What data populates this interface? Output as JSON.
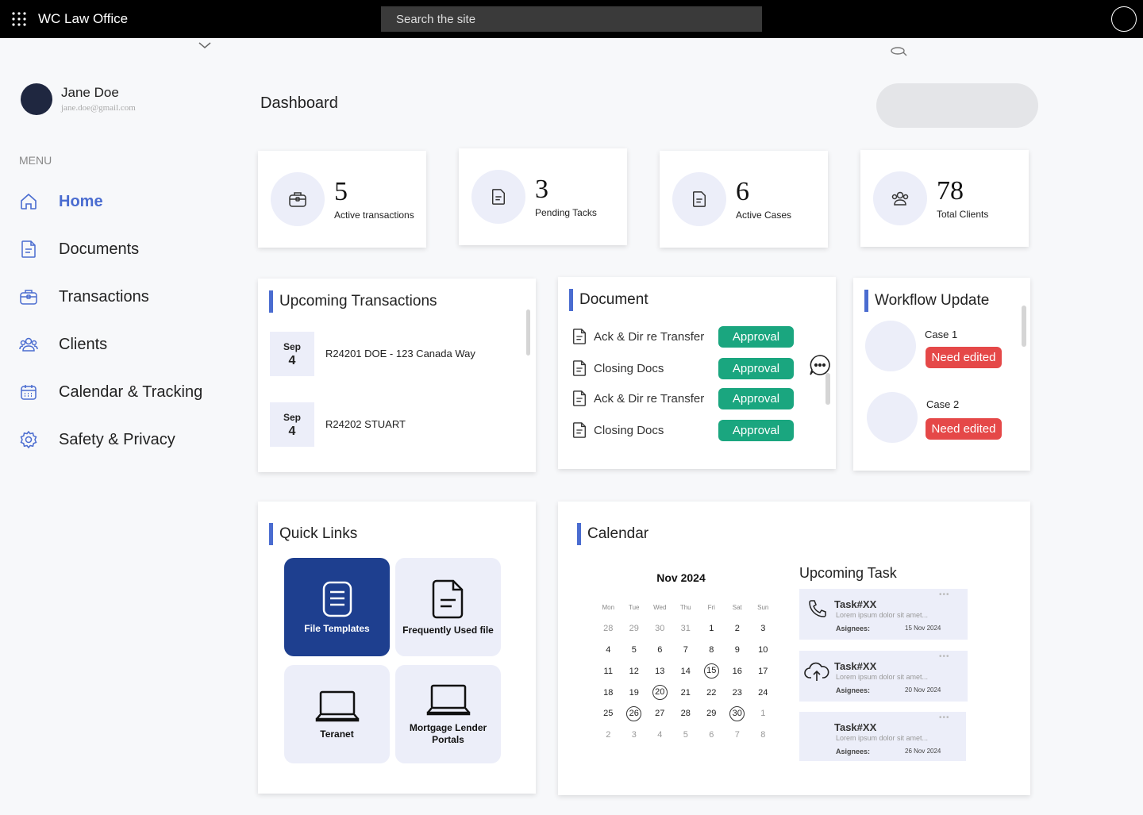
{
  "app": {
    "title": "WC Law Office",
    "search_placeholder": "Search the site"
  },
  "user": {
    "name": "Jane Doe",
    "email": "jane.doe@gmail.com"
  },
  "sidebar": {
    "menu_label": "MENU",
    "items": [
      {
        "label": "Home",
        "icon": "home-icon",
        "active": true
      },
      {
        "label": "Documents",
        "icon": "document-icon"
      },
      {
        "label": "Transactions",
        "icon": "briefcase-icon"
      },
      {
        "label": "Clients",
        "icon": "users-icon"
      },
      {
        "label": "Calendar & Tracking",
        "icon": "calendar-icon"
      },
      {
        "label": "Safety & Privacy",
        "icon": "gear-icon"
      }
    ]
  },
  "page": {
    "title": "Dashboard"
  },
  "stats": [
    {
      "value": "5",
      "label": "Active transactions",
      "icon": "briefcase-icon"
    },
    {
      "value": "3",
      "label": "Pending Tacks",
      "icon": "document-icon"
    },
    {
      "value": "6",
      "label": "Active Cases",
      "icon": "document-icon"
    },
    {
      "value": "78",
      "label": "Total Clients",
      "icon": "users-icon"
    }
  ],
  "upcoming_transactions": {
    "title": "Upcoming Transactions",
    "items": [
      {
        "month": "Sep",
        "day": "4",
        "text": "R24201 DOE  - 123 Canada Way"
      },
      {
        "month": "Sep",
        "day": "4",
        "text": "R24202 STUART"
      }
    ]
  },
  "documents": {
    "title": "Document",
    "items": [
      {
        "name": "Ack & Dir re Transfer",
        "status": "Approval"
      },
      {
        "name": "Closing  Docs",
        "status": "Approval"
      },
      {
        "name": "Ack & Dir re Transfer",
        "status": "Approval"
      },
      {
        "name": "Closing  Docs",
        "status": "Approval"
      }
    ]
  },
  "workflow": {
    "title": "Workflow Update",
    "items": [
      {
        "case": "Case 1",
        "status": "Need edited"
      },
      {
        "case": "Case 2",
        "status": "Need edited"
      }
    ]
  },
  "quick_links": {
    "title": "Quick Links",
    "items": [
      {
        "label": "File Templates",
        "icon": "file-template-icon"
      },
      {
        "label": "Frequently Used file",
        "icon": "file-icon"
      },
      {
        "label": "Teranet",
        "icon": "laptop-icon"
      },
      {
        "label": "Mortgage Lender Portals",
        "icon": "laptop-icon"
      }
    ]
  },
  "calendar": {
    "title": "Calendar",
    "month": "Nov 2024",
    "weekdays": [
      "Mon",
      "Tue",
      "Wed",
      "Thu",
      "Fri",
      "Sat",
      "Sun"
    ],
    "weeks": [
      [
        "28",
        "29",
        "30",
        "31",
        "1",
        "2",
        "3"
      ],
      [
        "4",
        "5",
        "6",
        "7",
        "8",
        "9",
        "10"
      ],
      [
        "11",
        "12",
        "13",
        "14",
        "15",
        "16",
        "17"
      ],
      [
        "18",
        "19",
        "20",
        "21",
        "22",
        "23",
        "24"
      ],
      [
        "25",
        "26",
        "27",
        "28",
        "29",
        "30",
        "1"
      ],
      [
        "2",
        "3",
        "4",
        "5",
        "6",
        "7",
        "8"
      ]
    ],
    "highlighted": [
      "15",
      "20",
      "26",
      "30"
    ]
  },
  "upcoming_task": {
    "title": "Upcoming Task",
    "items": [
      {
        "title": "Task#XX",
        "desc": "Lorem ipsum dolor sit amet...",
        "assignees_label": "Asignees:",
        "date": "15 Nov 2024",
        "icon": "phone-icon"
      },
      {
        "title": "Task#XX",
        "desc": "Lorem ipsum dolor sit amet...",
        "assignees_label": "Asignees:",
        "date": "20 Nov 2024",
        "icon": "cloud-upload-icon"
      },
      {
        "title": "Task#XX",
        "desc": "Lorem ipsum dolor sit amet...",
        "assignees_label": "Asignees:",
        "date": "26 Nov 2024",
        "icon": ""
      }
    ]
  },
  "colors": {
    "accent": "#4a6cd0",
    "approval": "#1aa67f",
    "need_edit": "#e54848",
    "quick_primary": "#1e3f8f",
    "icon_bg": "#eceef9"
  }
}
